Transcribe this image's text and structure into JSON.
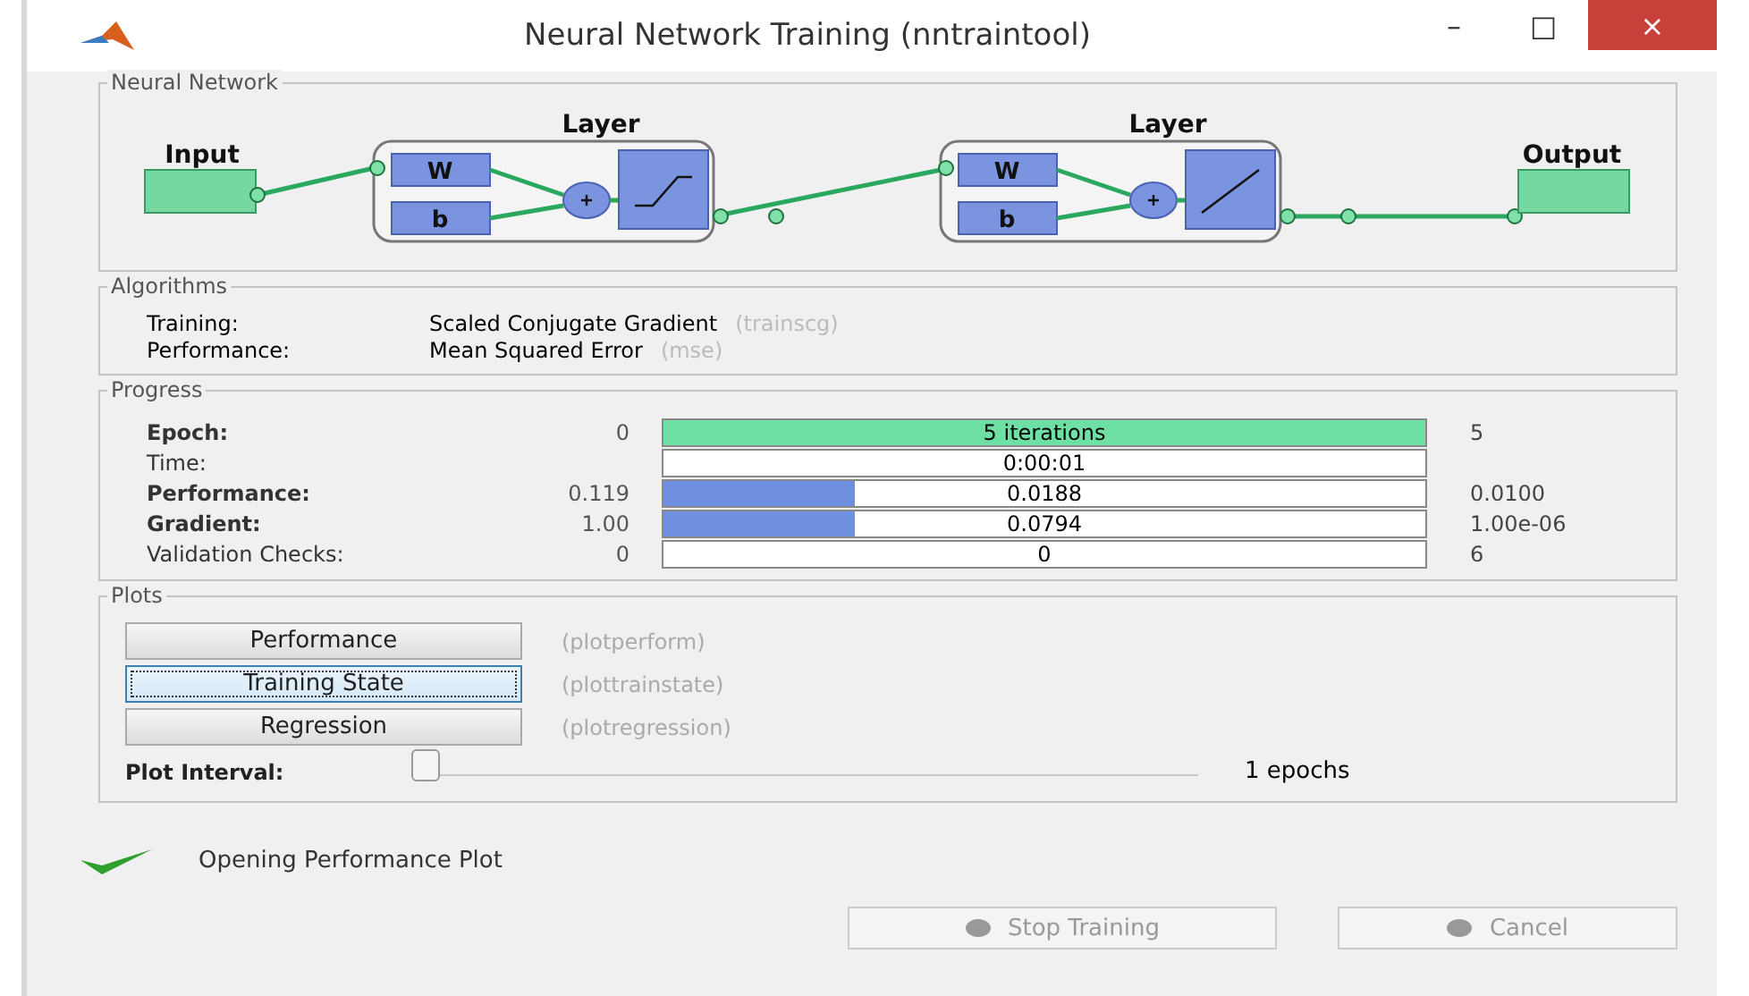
{
  "window": {
    "title": "Neural Network Training (nntraintool)",
    "controls": [
      "–",
      "□",
      "×"
    ]
  },
  "network": {
    "title": "Neural Network",
    "input": "Input",
    "output": "Output",
    "layers": [
      {
        "label": "Layer",
        "weight": "W",
        "bias": "b",
        "kind": "sigmoid"
      },
      {
        "label": "Layer",
        "weight": "W",
        "bias": "b",
        "kind": "linear"
      }
    ]
  },
  "algorithms": {
    "title": "Algorithms",
    "rows": [
      {
        "label": "Training:",
        "value": "Scaled Conjugate Gradient",
        "function": "(trainscg)"
      },
      {
        "label": "Performance:",
        "value": "Mean Squared Error",
        "function": "(mse)"
      }
    ]
  },
  "progress": {
    "title": "Progress",
    "rows": [
      {
        "label": "Epoch:",
        "start": "0",
        "reading": "5 iterations",
        "end": "5",
        "level": 1,
        "kind": "epoch"
      },
      {
        "label": "Time:",
        "reading": "0:00:01",
        "kind": "time"
      },
      {
        "label": "Performance:",
        "start": "0.119",
        "reading": "0.0188",
        "end": "0.0100",
        "level": 0.25,
        "kind": "metric"
      },
      {
        "label": "Gradient:",
        "start": "1.00",
        "reading": "0.0794",
        "end": "1.00e-06",
        "level": 0.25,
        "kind": "metric"
      },
      {
        "label": "Validation Checks:",
        "start": "0",
        "reading": "0",
        "end": "6",
        "kind": "metric"
      }
    ]
  },
  "plots": {
    "title": "Plots",
    "buttons": [
      {
        "label": "Performance",
        "function": "(plotperform)",
        "focused": false
      },
      {
        "label": "Training State",
        "function": "(plottrainstate)",
        "focused": true
      },
      {
        "label": "Regression",
        "function": "(plotregression)",
        "focused": false
      }
    ],
    "interval": {
      "label": "Plot Interval:",
      "level": 0,
      "reading": "1 epochs"
    }
  },
  "status": {
    "message": "Opening Performance Plot",
    "done": true
  },
  "buttons": [
    {
      "label": "Stop Training",
      "disabled": true
    },
    {
      "label": "Cancel",
      "disabled": true
    }
  ]
}
